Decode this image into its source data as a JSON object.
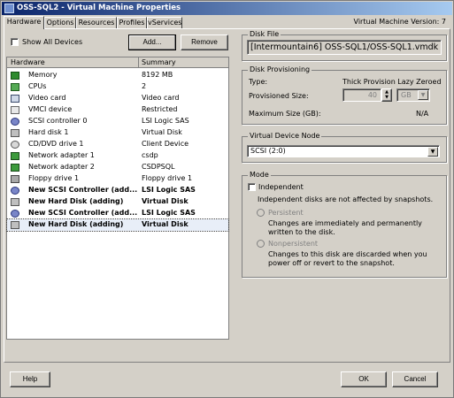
{
  "window": {
    "title": "OSS-SQL2 - Virtual Machine Properties",
    "version_label": "Virtual Machine Version: 7"
  },
  "tabs": [
    "Hardware",
    "Options",
    "Resources",
    "Profiles",
    "vServices"
  ],
  "toolbar": {
    "show_all_devices_label": "Show All Devices",
    "add_label": "Add...",
    "remove_label": "Remove"
  },
  "hardware_table": {
    "columns": [
      "Hardware",
      "Summary"
    ],
    "rows": [
      {
        "name": "Memory",
        "summary": "8192 MB",
        "icon": "memory-icon"
      },
      {
        "name": "CPUs",
        "summary": "2",
        "icon": "cpu-icon"
      },
      {
        "name": "Video card",
        "summary": "Video card",
        "icon": "video-card-icon"
      },
      {
        "name": "VMCI device",
        "summary": "Restricted",
        "icon": "vmci-icon"
      },
      {
        "name": "SCSI controller 0",
        "summary": "LSI Logic SAS",
        "icon": "scsi-controller-icon"
      },
      {
        "name": "Hard disk 1",
        "summary": "Virtual Disk",
        "icon": "hard-disk-icon"
      },
      {
        "name": "CD/DVD drive 1",
        "summary": "Client Device",
        "icon": "cd-dvd-icon"
      },
      {
        "name": "Network adapter 1",
        "summary": "csdp",
        "icon": "network-adapter-icon"
      },
      {
        "name": "Network adapter 2",
        "summary": "CSDPSQL",
        "icon": "network-adapter-icon"
      },
      {
        "name": "Floppy drive 1",
        "summary": "Floppy drive 1",
        "icon": "floppy-icon"
      },
      {
        "name": "New SCSI Controller (add...",
        "summary": "LSI Logic SAS",
        "icon": "scsi-controller-icon"
      },
      {
        "name": "New Hard Disk (adding)",
        "summary": "Virtual Disk",
        "icon": "hard-disk-icon"
      },
      {
        "name": "New SCSI Controller (add...",
        "summary": "LSI Logic SAS",
        "icon": "scsi-controller-icon"
      },
      {
        "name": "New Hard Disk (adding)",
        "summary": "Virtual Disk",
        "icon": "hard-disk-icon"
      }
    ]
  },
  "disk_file": {
    "title": "Disk File",
    "value": "[Intermountain6] OSS-SQL1/OSS-SQL1.vmdk"
  },
  "provisioning": {
    "title": "Disk Provisioning",
    "type_label": "Type:",
    "type_value": "Thick Provision Lazy Zeroed",
    "size_label": "Provisioned Size:",
    "size_value": "40",
    "size_unit": "GB",
    "max_label": "Maximum Size (GB):",
    "max_value": "N/A"
  },
  "device_node": {
    "title": "Virtual Device Node",
    "value": "SCSI (2:0)"
  },
  "mode": {
    "title": "Mode",
    "independent_label": "Independent",
    "independent_desc": "Independent disks are not affected by snapshots.",
    "persistent_label": "Persistent",
    "persistent_desc": "Changes are immediately and permanently written to the disk.",
    "nonpersistent_label": "Nonpersistent",
    "nonpersistent_desc": "Changes to this disk are discarded when you power off or revert to the snapshot."
  },
  "footer": {
    "help_label": "Help",
    "ok_label": "OK",
    "cancel_label": "Cancel"
  }
}
